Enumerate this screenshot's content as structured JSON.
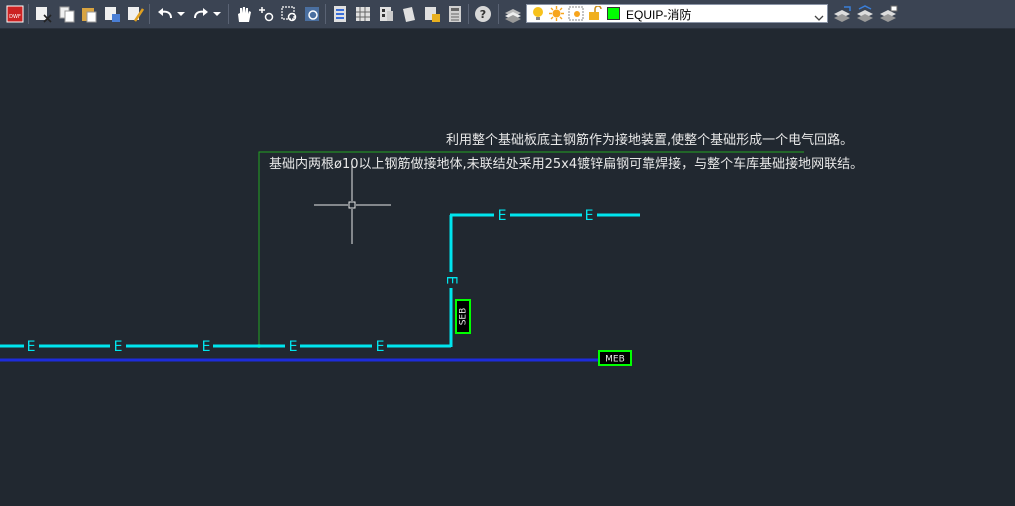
{
  "toolbar": {
    "icons": [
      "dwf-publish-icon",
      "cut-icon",
      "copy-icon",
      "paste-icon",
      "match-properties-icon",
      "brush-icon",
      "undo-icon",
      "undo-dropdown-icon",
      "redo-icon",
      "redo-dropdown-icon",
      "pan-icon",
      "zoom-realtime-icon",
      "zoom-window-icon",
      "zoom-previous-icon",
      "properties-icon",
      "design-center-icon",
      "tool-palettes-icon",
      "sheet-set-icon",
      "markup-icon",
      "calculator-icon",
      "help-icon",
      "layer-properties-icon",
      "layer-icon-group",
      "layer-dropdown-arrow-icon",
      "make-current-layer-icon",
      "layer-previous-icon",
      "layer-state-icon"
    ],
    "dwf_label": "DWF",
    "layer": {
      "name": "EQUIP-消防",
      "color": "#00ff00"
    }
  },
  "drawing": {
    "background": "#212830",
    "colors": {
      "cyan": "#00e5ee",
      "blue": "#1d2cdb",
      "green": "#22a522",
      "bright_green": "#00ff00",
      "text": "#e8e8e8"
    },
    "notes": [
      "利用整个基础板底主钢筋作为接地装置,使整个基础形成一个电气回路。",
      "基础内两根ø10以上钢筋做接地体,未联结处采用25x4镀锌扁钢可靠焊接，与整个车库基础接地网联结。"
    ],
    "conductor_label": "E",
    "seb_label": "SEB",
    "meb_label": "MEB"
  }
}
